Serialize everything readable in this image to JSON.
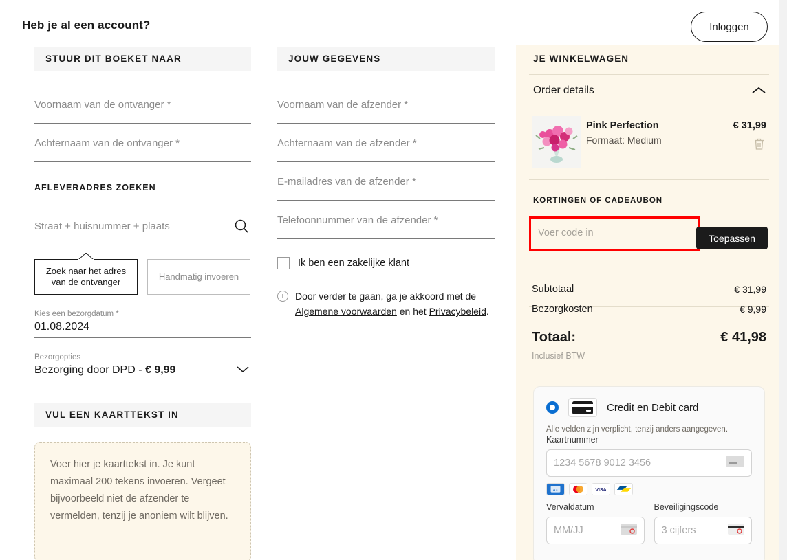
{
  "header": {
    "title": "Heb je al een account?",
    "login_label": "Inloggen"
  },
  "recipient_section": {
    "heading": "STUUR DIT BOEKET NAAR",
    "first_name_placeholder": "Voornaam van de ontvanger *",
    "last_name_placeholder": "Achternaam van de ontvanger *",
    "address_search_label": "AFLEVERADRES ZOEKEN",
    "address_search_placeholder": "Straat + huisnummer + plaats",
    "search_icon": "search-icon",
    "toggle_search_label": "Zoek naar het adres van de ontvanger",
    "toggle_manual_label": "Handmatig invoeren",
    "delivery_date_label": "Kies een bezorgdatum *",
    "delivery_date_value": "01.08.2024",
    "delivery_option_label": "Bezorgopties",
    "delivery_option_value": "Bezorging door DPD -",
    "delivery_option_price": "€ 9,99",
    "chevron_icon": "chevron-down-icon"
  },
  "card_section": {
    "heading": "VUL EEN KAARTTEKST IN",
    "placeholder": "Voer hier je kaarttekst in. Je kunt maximaal 200 tekens invoeren. Vergeet bijvoorbeeld niet de afzender te vermelden, tenzij je anoniem wilt blijven."
  },
  "sender_section": {
    "heading": "JOUW GEGEVENS",
    "first_name_placeholder": "Voornaam van de afzender *",
    "last_name_placeholder": "Achternaam van de afzender *",
    "email_placeholder": "E-mailadres van de afzender *",
    "phone_placeholder": "Telefoonnummer van de afzender *",
    "business_checkbox_label": "Ik ben een zakelijke klant",
    "terms_prefix": "Door verder te gaan, ga je akkoord met de",
    "terms_link": "Algemene voorwaarden",
    "terms_middle": "en het",
    "privacy_link": "Privacybeleid",
    "terms_suffix": ".",
    "info_icon": "info-icon"
  },
  "cart": {
    "heading": "JE WINKELWAGEN",
    "order_details_label": "Order details",
    "collapse_icon": "chevron-up-icon",
    "item": {
      "name": "Pink Perfection",
      "option": "Formaat: Medium",
      "price": "€ 31,99",
      "delete_icon": "trash-icon",
      "thumbnail": "bouquet-thumbnail"
    },
    "coupon_label": "KORTINGEN OF CADEAUBON",
    "coupon_placeholder": "Voer code in",
    "coupon_value": "",
    "apply_label": "Toepassen",
    "highlight_color": "#ff0000",
    "summary": [
      {
        "label": "Subtotaal",
        "value": "€ 31,99"
      },
      {
        "label": "Bezorgkosten",
        "value": "€ 9,99"
      }
    ],
    "total_label": "Totaal:",
    "total_value": "€ 41,98",
    "vat_note": "Inclusief BTW",
    "panel_color": "#fdf7ea"
  },
  "payment": {
    "method_name": "Credit en Debit card",
    "card_icon": "credit-card-icon",
    "radio_selected": true,
    "accent_color": "#0a6ed1",
    "note": "Alle velden zijn verplicht, tenzij anders aangegeven.",
    "card_number_label": "Kaartnummer",
    "card_number_placeholder": "1234 5678 9012 3456",
    "brands": [
      "amex-icon",
      "mastercard-icon",
      "visa-icon",
      "bancontact-icon"
    ],
    "expiry_label": "Vervaldatum",
    "expiry_placeholder": "MM/JJ",
    "cvc_label": "Beveiligingscode",
    "cvc_placeholder": "3 cijfers"
  }
}
